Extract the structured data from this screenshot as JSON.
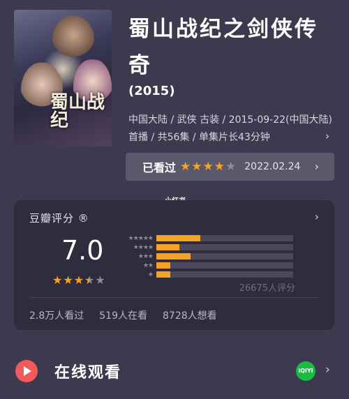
{
  "movie": {
    "title": "蜀山战纪之剑侠传奇",
    "year": "(2015)",
    "meta": "中国大陆 / 武侠 古装 / 2015-09-22(中国大陆)首播 / 共56集 / 单集片长43分钟",
    "poster_title": "蜀山战纪"
  },
  "watched": {
    "label": "已看过",
    "stars_on": 4,
    "stars_total": 5,
    "date": "2022.02.24"
  },
  "watermark": "小红书",
  "douban": {
    "title": "豆瓣评分 ®",
    "score": "7.0",
    "stars": 3.5,
    "distribution_pct": [
      32,
      17,
      25,
      10,
      10
    ],
    "rating_count": "26675人评分",
    "stats": [
      "2.8万人看过",
      "519人在看",
      "8728人想看"
    ]
  },
  "online": {
    "label": "在线观看",
    "provider_badge": "iQIYI"
  },
  "colors": {
    "accent_star": "#f4a325",
    "background": "#3d3a4f",
    "card": "#2f2c3e",
    "play": "#f25a5a",
    "iqiyi": "#1bbb3f"
  }
}
